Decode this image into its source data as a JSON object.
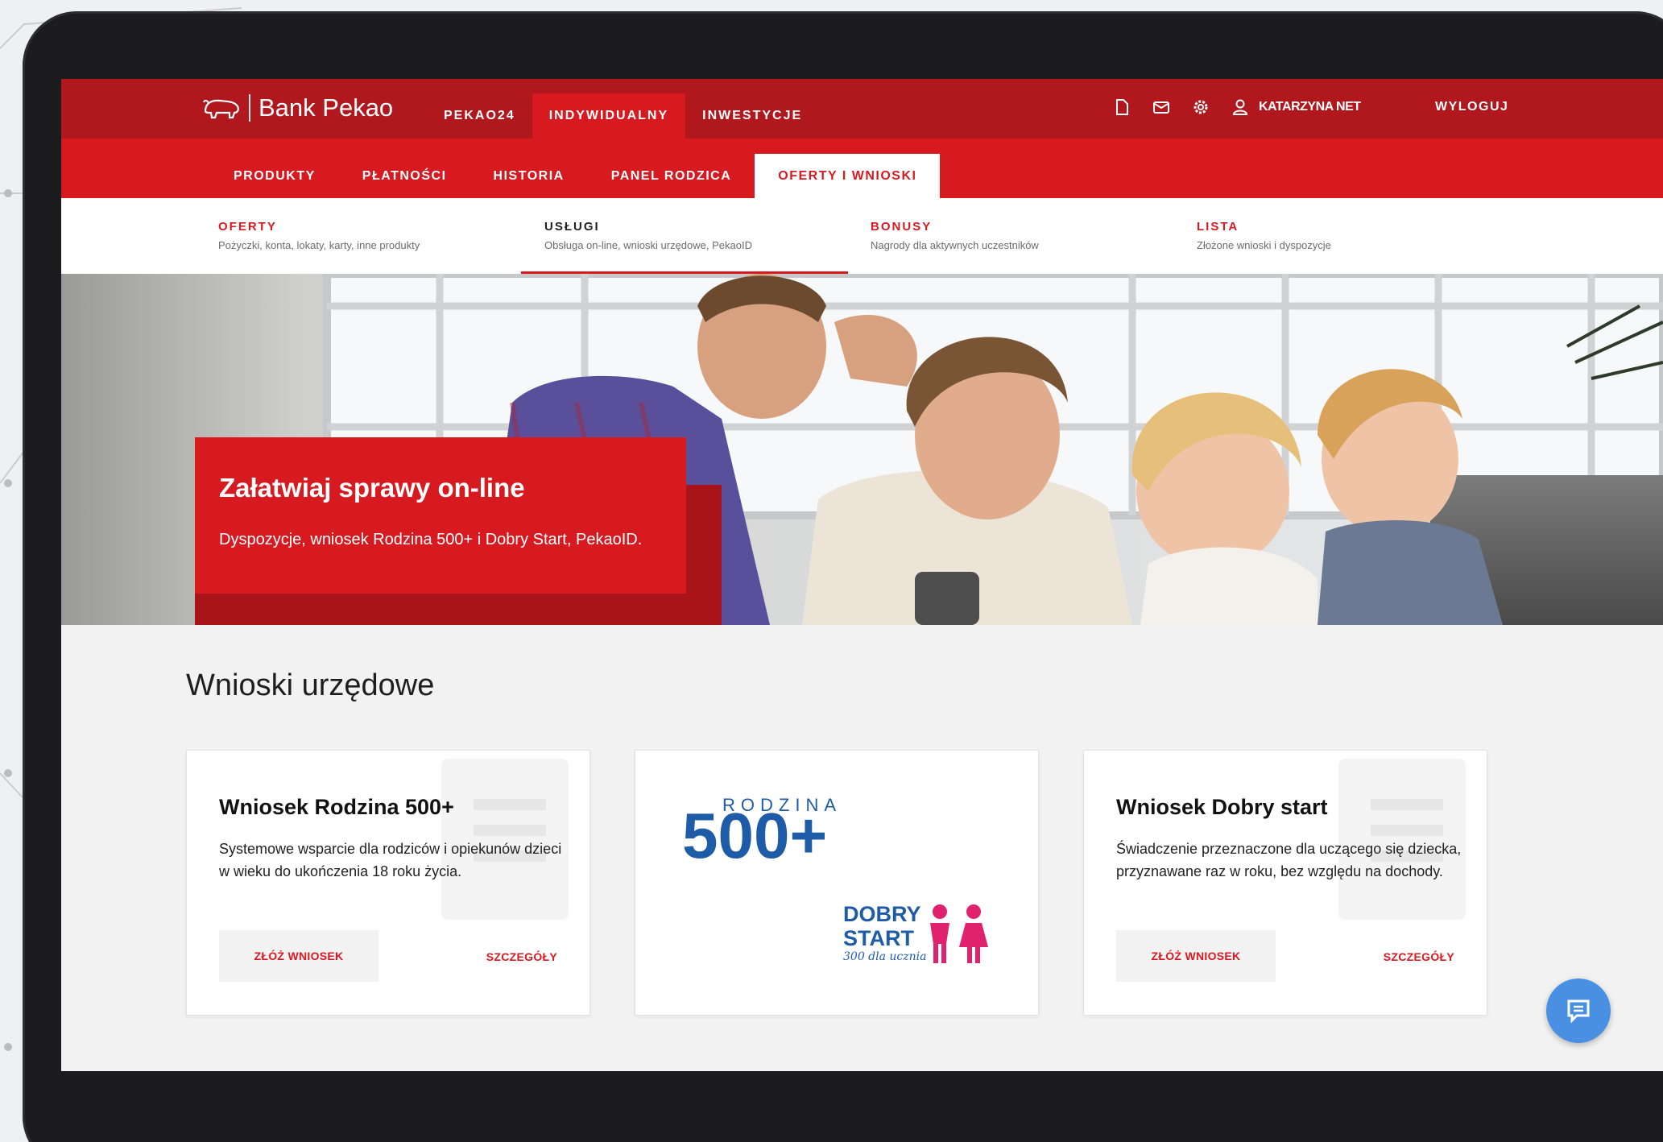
{
  "header": {
    "brand": "Bank Pekao",
    "tabs": [
      {
        "label": "PEKAO24"
      },
      {
        "label": "INDYWIDUALNY"
      },
      {
        "label": "INWESTYCJE"
      }
    ],
    "user_name": "KATARZYNA NET",
    "logout_label": "WYLOGUJ",
    "icons": [
      "document-icon",
      "mail-icon",
      "settings-icon",
      "user-icon"
    ]
  },
  "nav": {
    "items": [
      {
        "label": "PRODUKTY"
      },
      {
        "label": "PŁATNOŚCI"
      },
      {
        "label": "HISTORIA"
      },
      {
        "label": "PANEL RODZICA"
      },
      {
        "label": "OFERTY I WNIOSKI"
      }
    ]
  },
  "subnav": {
    "items": [
      {
        "title": "OFERTY",
        "desc": "Pożyczki, konta, lokaty, karty, inne produkty"
      },
      {
        "title": "USŁUGI",
        "desc": "Obsługa on-line, wnioski urzędowe, PekaoID"
      },
      {
        "title": "BONUSY",
        "desc": "Nagrody dla aktywnych uczestników"
      },
      {
        "title": "LISTA",
        "desc": "Złożone wnioski i dyspozycje"
      }
    ]
  },
  "hero": {
    "title": "Załatwiaj sprawy on-line",
    "subtitle": "Dyspozycje, wniosek Rodzina 500+ i Dobry Start, PekaoID."
  },
  "section": {
    "title": "Wnioski urzędowe",
    "cards": [
      {
        "title": "Wniosek Rodzina 500+",
        "desc": "Systemowe wsparcie dla rodziców i opiekunów dzieci w wieku do ukończenia 18 roku życia.",
        "button": "ZŁÓŻ WNIOSEK",
        "link": "SZCZEGÓŁY"
      },
      {
        "logo_top": "RODZINA",
        "logo_num": "500+",
        "logo_dobry_1": "DOBRY",
        "logo_dobry_2": "START",
        "logo_dobry_3": "300 dla ucznia"
      },
      {
        "title": "Wniosek Dobry start",
        "desc": "Świadczenie przeznaczone dla uczącego się dziecka, przyznawane raz w roku, bez względu na dochody.",
        "button": "ZŁÓŻ WNIOSEK",
        "link": "SZCZEGÓŁY"
      }
    ]
  },
  "colors": {
    "brand_dark": "#b1181d",
    "brand": "#d71920",
    "chat_button": "#4a90e2",
    "program_blue": "#1f5ca8",
    "program_pink": "#e0216e"
  }
}
